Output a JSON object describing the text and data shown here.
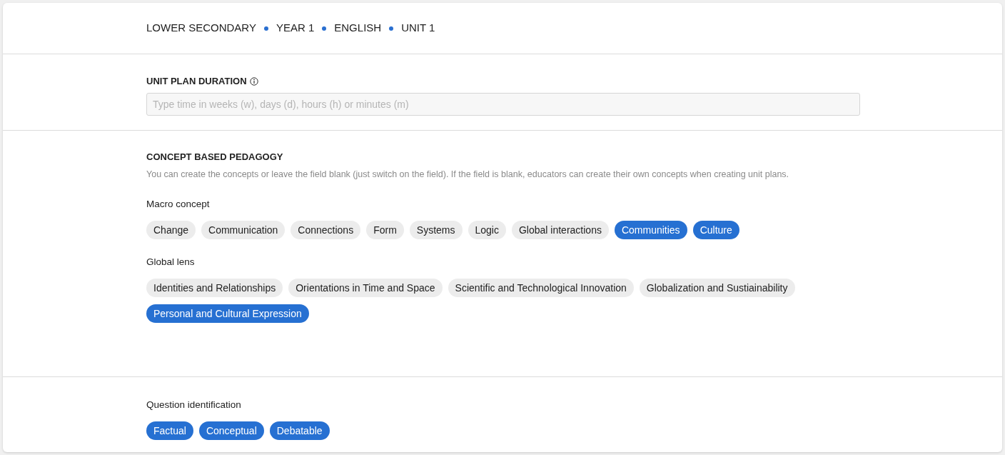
{
  "breadcrumb": [
    "LOWER SECONDARY",
    "YEAR 1",
    "ENGLISH",
    "UNIT 1"
  ],
  "duration": {
    "label": "UNIT PLAN DURATION",
    "placeholder": "Type time in weeks (w), days (d), hours (h) or minutes (m)"
  },
  "concept": {
    "title": "CONCEPT BASED PEDAGOGY",
    "description": "You can create the concepts or leave the field blank (just switch on the field). If the field is blank, educators can create their own concepts when creating unit plans.",
    "groups": [
      {
        "label": "Macro concept",
        "chips": [
          {
            "label": "Change",
            "selected": false
          },
          {
            "label": "Communication",
            "selected": false
          },
          {
            "label": "Connections",
            "selected": false
          },
          {
            "label": "Form",
            "selected": false
          },
          {
            "label": "Systems",
            "selected": false
          },
          {
            "label": "Logic",
            "selected": false
          },
          {
            "label": "Global interactions",
            "selected": false
          },
          {
            "label": "Communities",
            "selected": true
          },
          {
            "label": "Culture",
            "selected": true
          }
        ]
      },
      {
        "label": "Global lens",
        "chips": [
          {
            "label": "Identities and Relationships",
            "selected": false
          },
          {
            "label": "Orientations in Time and Space",
            "selected": false
          },
          {
            "label": "Scientific and Technological Innovation",
            "selected": false
          },
          {
            "label": "Globalization and Sustiainability",
            "selected": false
          },
          {
            "label": "Personal and Cultural Expression",
            "selected": true
          }
        ]
      }
    ]
  },
  "question": {
    "label": "Question identification",
    "chips": [
      {
        "label": "Factual",
        "selected": true
      },
      {
        "label": "Conceptual",
        "selected": true
      },
      {
        "label": "Debatable",
        "selected": true
      }
    ]
  }
}
